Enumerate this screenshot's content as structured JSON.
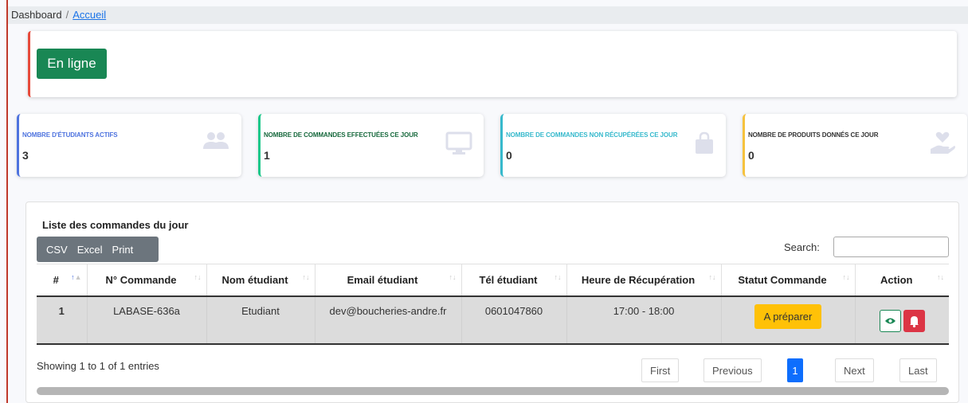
{
  "breadcrumb": {
    "root": "Dashboard",
    "separator": "/",
    "current": "Accueil"
  },
  "status": {
    "online_label": "En ligne"
  },
  "stats": [
    {
      "label": "NOMBRE D'ÉTUDIANTS ACTIFS",
      "value": "3",
      "icon": "users-icon",
      "accent": "#4e73df"
    },
    {
      "label": "NOMBRE DE COMMANDES EFFECTUÉES CE JOUR",
      "value": "1",
      "icon": "monitor-icon",
      "accent": "#1cc88a"
    },
    {
      "label": "NOMBRE DE COMMANDES NON RÉCUPÉRÉES CE JOUR",
      "value": "0",
      "icon": "shopping-bag-icon",
      "accent": "#36b9cc"
    },
    {
      "label": "NOMBRE DE PRODUITS DONNÉS CE JOUR",
      "value": "0",
      "icon": "hand-heart-icon",
      "accent": "#f6c23e"
    }
  ],
  "orders": {
    "title": "Liste des commandes du jour",
    "export_buttons": [
      "CSV",
      "Excel",
      "Print"
    ],
    "search_label": "Search:",
    "search_value": "",
    "columns": [
      "#",
      "N° Commande",
      "Nom étudiant",
      "Email étudiant",
      "Tél étudiant",
      "Heure de Récupération",
      "Statut Commande",
      "Action"
    ],
    "rows": [
      {
        "index": "1",
        "order_number": "LABASE-636a",
        "student_name": "Etudiant",
        "email": "dev@boucheries-andre.fr",
        "phone": "0601047860",
        "pickup_time": "17:00 - 18:00",
        "status": "A préparer"
      }
    ],
    "info": "Showing 1 to 1 of 1 entries",
    "pagination": {
      "first": "First",
      "previous": "Previous",
      "current": "1",
      "next": "Next",
      "last": "Last"
    }
  },
  "colors": {
    "online": "#198754",
    "status_badge": "#ffc107",
    "view_button": "#198754",
    "notify_button": "#dc3545",
    "page_active": "#0d6efd"
  }
}
